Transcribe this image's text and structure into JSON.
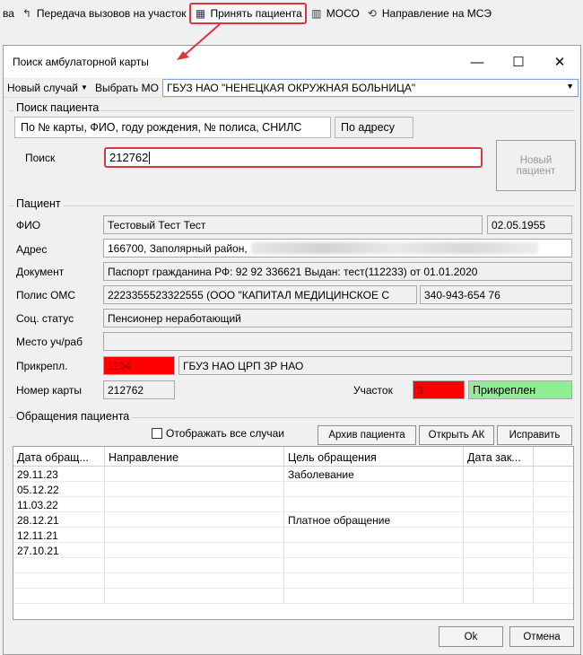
{
  "toolbar": {
    "items": [
      {
        "label": "ва"
      },
      {
        "label": "Передача вызовов на участок",
        "icon": "phone-transfer-icon"
      },
      {
        "label": "Принять пациента",
        "icon": "patient-card-icon"
      },
      {
        "label": "МОСО",
        "icon": "medical-document-icon"
      },
      {
        "label": "Направление на МСЭ",
        "icon": "refresh-arrows-icon"
      }
    ]
  },
  "dialog": {
    "title": "Поиск амбулаторной карты",
    "window_buttons": [
      "—",
      "☐",
      "✕"
    ]
  },
  "topbar": {
    "new_case": "Новый случай",
    "select_mo": "Выбрать МО",
    "mo_value": "ГБУЗ НАО \"НЕНЕЦКАЯ ОКРУЖНАЯ БОЛЬНИЦА\""
  },
  "search": {
    "section": "Поиск пациента",
    "tab1": "По № карты, ФИО, году рождения, № полиса, СНИЛС",
    "tab2": "По адресу",
    "label": "Поиск",
    "value": "212762",
    "new_patient": "Новый пациент"
  },
  "patient": {
    "section": "Пациент",
    "labels": {
      "fio": "ФИО",
      "address": "Адрес",
      "document": "Документ",
      "policy": "Полис ОМС",
      "social": "Соц. статус",
      "work": "Место уч/раб",
      "attach": "Прикрепл.",
      "card": "Номер карты",
      "district": "Участок"
    },
    "fio": "Тестовый Тест Тест",
    "birth": "02.05.1955",
    "address": "166700, Заполярный район,",
    "document": "Паспорт гражданина РФ: 92 92 336621 Выдан: тест(112233) от 01.01.2020",
    "policy": "2223355523322555 (ООО \"КАПИТАЛ МЕДИЦИНСКОЕ С",
    "snils": "340-943-654 76",
    "social": "Пенсионер неработающий",
    "work": "",
    "attach_code": "1104",
    "attach_name": "ГБУЗ НАО ЦРП ЗР НАО",
    "card": "212762",
    "district": "3",
    "attach_status": "Прикреплен"
  },
  "visits": {
    "section": "Обращения пациента",
    "show_all": "Отображать все случаи",
    "btn_archive": "Архив пациента",
    "btn_open": "Открыть АК",
    "btn_fix": "Исправить",
    "columns": [
      "Дата обращ...",
      "Направление",
      "Цель обращения",
      "Дата зак..."
    ],
    "rows": [
      {
        "date": "29.11.23",
        "direction": "",
        "goal": "Заболевание",
        "close": ""
      },
      {
        "date": "05.12.22",
        "direction": "",
        "goal": "",
        "close": ""
      },
      {
        "date": "11.03.22",
        "direction": "",
        "goal": "",
        "close": ""
      },
      {
        "date": "28.12.21",
        "direction": "",
        "goal": "Платное обращение",
        "close": ""
      },
      {
        "date": "12.11.21",
        "direction": "",
        "goal": "",
        "close": ""
      },
      {
        "date": "27.10.21",
        "direction": "",
        "goal": "",
        "close": ""
      }
    ]
  },
  "footer": {
    "ok": "Ok",
    "cancel": "Отмена"
  },
  "colors": {
    "highlight": "#d9363e",
    "attach_red": "#ff0000",
    "attach_green": "#90ee90",
    "combo_border": "#7aa7d8"
  }
}
